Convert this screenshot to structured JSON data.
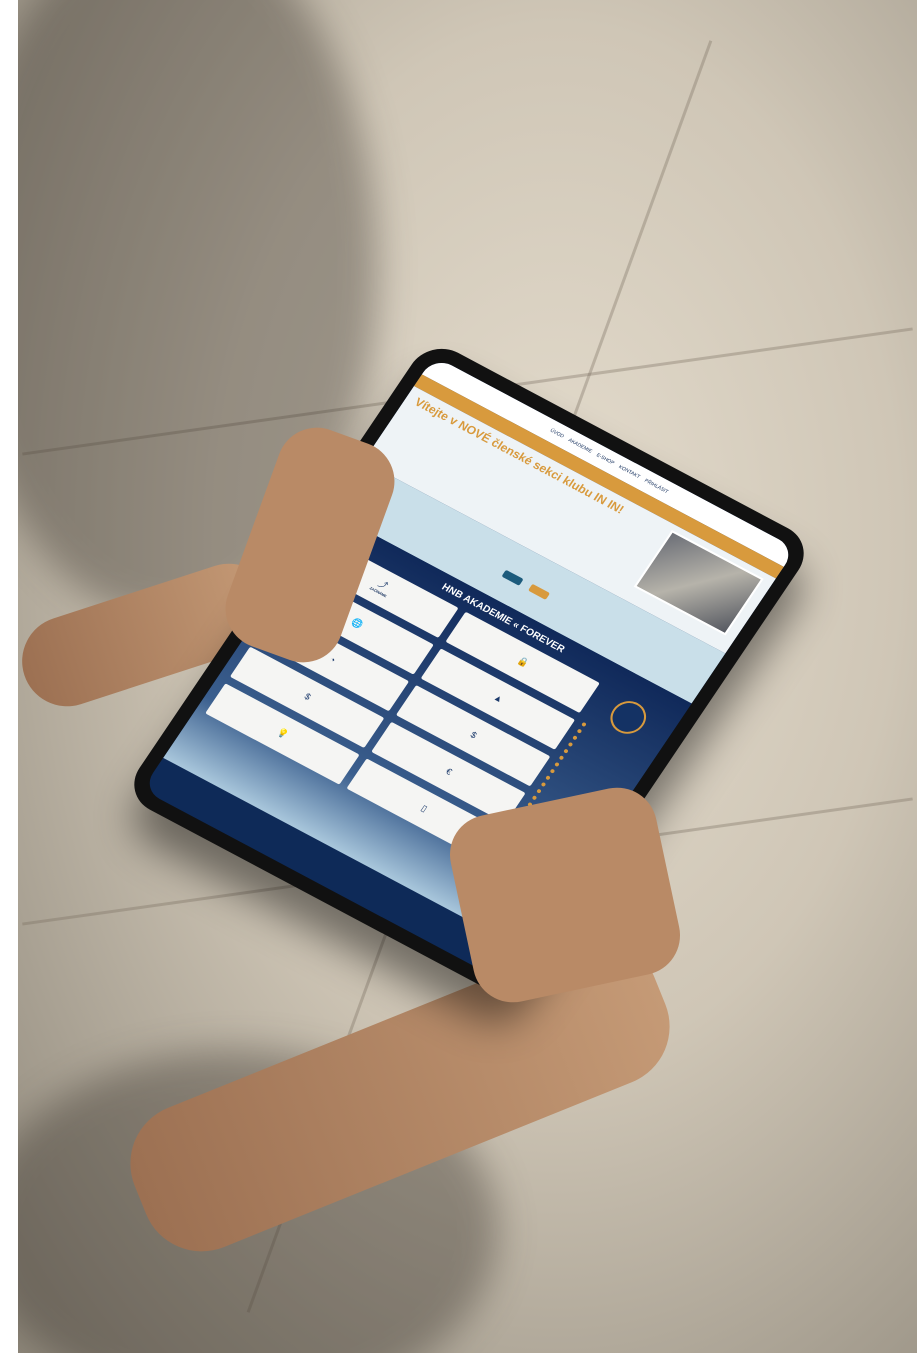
{
  "scene": {
    "description_colors": {
      "sofa": "#d8cfbf",
      "tablet_frame": "#111111",
      "navy": "#0e2a58",
      "gold": "#d89a3d"
    }
  },
  "site": {
    "nav_top": [
      "ÚVOD",
      "AKADEMIE",
      "E-SHOP",
      "KONTAKT",
      "PŘIHLÁSIT"
    ],
    "nav_bar": [
      "",
      "",
      "",
      "",
      "",
      "",
      ""
    ],
    "hero_title": "Vítejte v NOVÉ členské sekci klubu IN IN!",
    "hero_text": "",
    "strip_note": "",
    "btn_left": "",
    "btn_right": "",
    "academy_title": "HNB AKADEMIE « FOREVER",
    "academy_sub": "",
    "cards": [
      {
        "icon": "signpost-icon",
        "glyph": "⤴",
        "label": "ZAČÍNÁME"
      },
      {
        "icon": "lock-icon",
        "glyph": "🔒",
        "label": ""
      },
      {
        "icon": "globe-icon",
        "glyph": "🌐",
        "label": ""
      },
      {
        "icon": "chart-icon",
        "glyph": "▲",
        "label": ""
      },
      {
        "icon": "pie-icon",
        "glyph": "◔",
        "label": ""
      },
      {
        "icon": "dollar-icon",
        "glyph": "$",
        "label": ""
      },
      {
        "icon": "dollar-icon",
        "glyph": "$",
        "label": ""
      },
      {
        "icon": "euro-icon",
        "glyph": "€",
        "label": ""
      },
      {
        "icon": "bulb-icon",
        "glyph": "💡",
        "label": ""
      },
      {
        "icon": "phone-icon",
        "glyph": "▯",
        "label": ""
      }
    ],
    "side_title": "",
    "side_items": [
      "",
      "",
      "",
      "",
      "",
      "",
      "",
      "",
      "",
      "",
      "",
      "",
      ""
    ],
    "footer_link": ""
  }
}
